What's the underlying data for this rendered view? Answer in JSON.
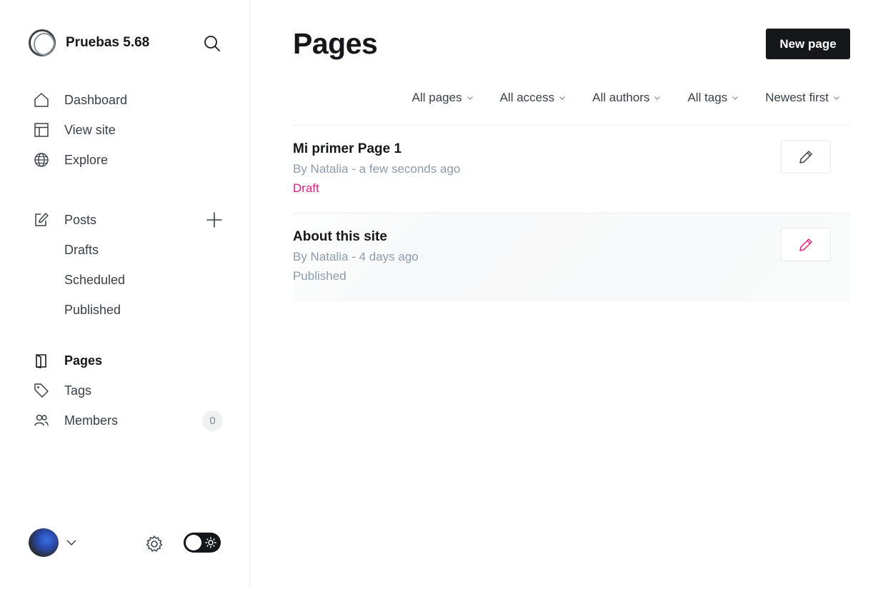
{
  "brand": {
    "title": "Pruebas 5.68"
  },
  "nav": {
    "dashboard": "Dashboard",
    "view_site": "View site",
    "explore": "Explore",
    "posts": "Posts",
    "posts_sub": [
      "Drafts",
      "Scheduled",
      "Published"
    ],
    "pages": "Pages",
    "tags": "Tags",
    "members": "Members",
    "members_count": "0"
  },
  "header": {
    "title": "Pages",
    "new_button": "New page"
  },
  "filters": [
    "All pages",
    "All access",
    "All authors",
    "All tags",
    "Newest first"
  ],
  "pages": [
    {
      "title": "Mi primer Page 1",
      "meta": "By Natalia - a few seconds ago",
      "status": "Draft"
    },
    {
      "title": "About this site",
      "meta": "By Natalia - 4 days ago",
      "status": "Published"
    }
  ],
  "colors": {
    "accent": "#e51e83",
    "dark": "#15171a",
    "muted": "#8e9cac"
  },
  "icons": {
    "brand": "brand-logo",
    "search": "search-icon",
    "dashboard": "home-icon",
    "view_site": "layout-icon",
    "explore": "globe-icon",
    "posts": "edit-icon",
    "add_post": "plus-icon",
    "pages": "page-icon",
    "tags": "tag-icon",
    "members": "members-icon",
    "settings": "gear-icon",
    "theme": "sun-icon",
    "edit": "pencil-icon"
  }
}
